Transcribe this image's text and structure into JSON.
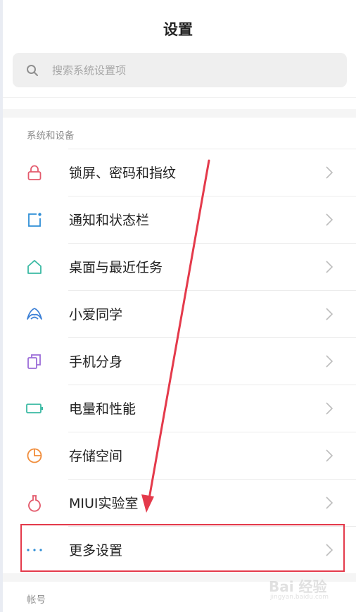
{
  "header": {
    "title": "设置"
  },
  "search": {
    "placeholder": "搜索系统设置项",
    "icon": "search-icon"
  },
  "sections": {
    "system_devices": {
      "label": "系统和设备",
      "items": [
        {
          "label": "锁屏、密码和指纹",
          "icon": "lock-icon",
          "color": "#e35a6c"
        },
        {
          "label": "通知和状态栏",
          "icon": "notification-icon",
          "color": "#2f8ed6"
        },
        {
          "label": "桌面与最近任务",
          "icon": "home-icon",
          "color": "#3ab9a3"
        },
        {
          "label": "小爱同学",
          "icon": "xiaoai-icon",
          "color": "#3b7fd6"
        },
        {
          "label": "手机分身",
          "icon": "second-space-icon",
          "color": "#9b6bd8"
        },
        {
          "label": "电量和性能",
          "icon": "battery-icon",
          "color": "#3ab9a3"
        },
        {
          "label": "存储空间",
          "icon": "storage-icon",
          "color": "#f08c3a"
        },
        {
          "label": "MIUI实验室",
          "icon": "lab-flask-icon",
          "color": "#e35a6c"
        },
        {
          "label": "更多设置",
          "icon": "more-dots-icon",
          "color": "#2f8ed6"
        }
      ]
    },
    "account": {
      "label": "帐号"
    }
  },
  "watermark": {
    "main": "Bai 经验",
    "sub": "jingyan.baidu.com"
  },
  "annotation": {
    "highlight_color": "#e43a4b",
    "arrow_color": "#e43a4b"
  }
}
